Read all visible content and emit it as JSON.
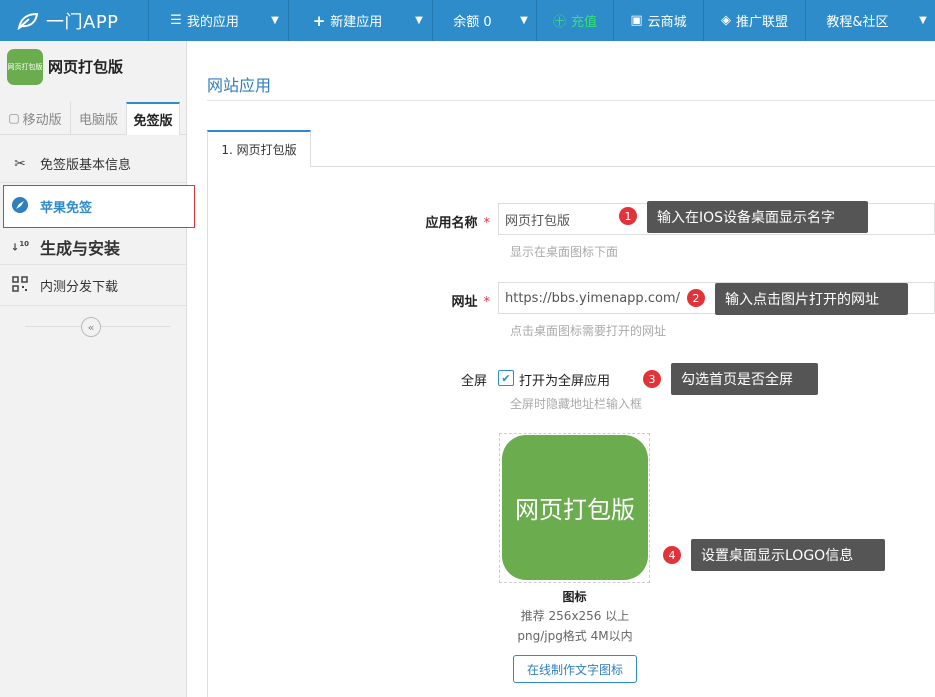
{
  "topbar": {
    "brand": "一门APP",
    "my_apps": "我的应用",
    "new_app": "新建应用",
    "balance": "余额 0",
    "recharge": "充值",
    "cloud_store": "云商城",
    "promo": "推广联盟",
    "tutorial": "教程&社区"
  },
  "sidebar": {
    "app_icon_text": "网页打包版",
    "app_name": "网页打包版",
    "tabs": [
      "移动版",
      "电脑版",
      "免签版"
    ],
    "items": [
      {
        "label": "免签版基本信息",
        "icon": "scissors-icon"
      },
      {
        "label": "苹果免签",
        "icon": "compass-icon"
      },
      {
        "label": "生成与安装",
        "icon": "sort-numeric-icon"
      },
      {
        "label": "内测分发下载",
        "icon": "qrcode-icon"
      }
    ],
    "collapse": "«"
  },
  "main": {
    "page_title": "网站应用",
    "tab": "1. 网页打包版",
    "fields": {
      "name_label": "应用名称",
      "name_value": "网页打包版",
      "name_help": "显示在桌面图标下面",
      "url_label": "网址",
      "url_value": "https://bbs.yimenapp.com/",
      "url_help": "点击桌面图标需要打开的网址",
      "fullscreen_label": "全屏",
      "fullscreen_option": "打开为全屏应用",
      "fullscreen_checked": true,
      "fullscreen_help": "全屏时隐藏地址栏输入框",
      "required_mark": "*"
    },
    "logo": {
      "text": "网页打包版",
      "caption": "图标",
      "note1": "推荐 256x256 以上",
      "note2": "png/jpg格式 4M以内",
      "make_button": "在线制作文字图标"
    },
    "annotations": [
      {
        "num": "1",
        "text": "输入在IOS设备桌面显示名字"
      },
      {
        "num": "2",
        "text": "输入点击图片打开的网址"
      },
      {
        "num": "3",
        "text": "勾选首页是否全屏"
      },
      {
        "num": "4",
        "text": "设置桌面显示LOGO信息"
      }
    ]
  },
  "colors": {
    "brand_blue": "#2d8cc9",
    "app_green": "#6aac4e",
    "badge_red": "#e3333a"
  }
}
